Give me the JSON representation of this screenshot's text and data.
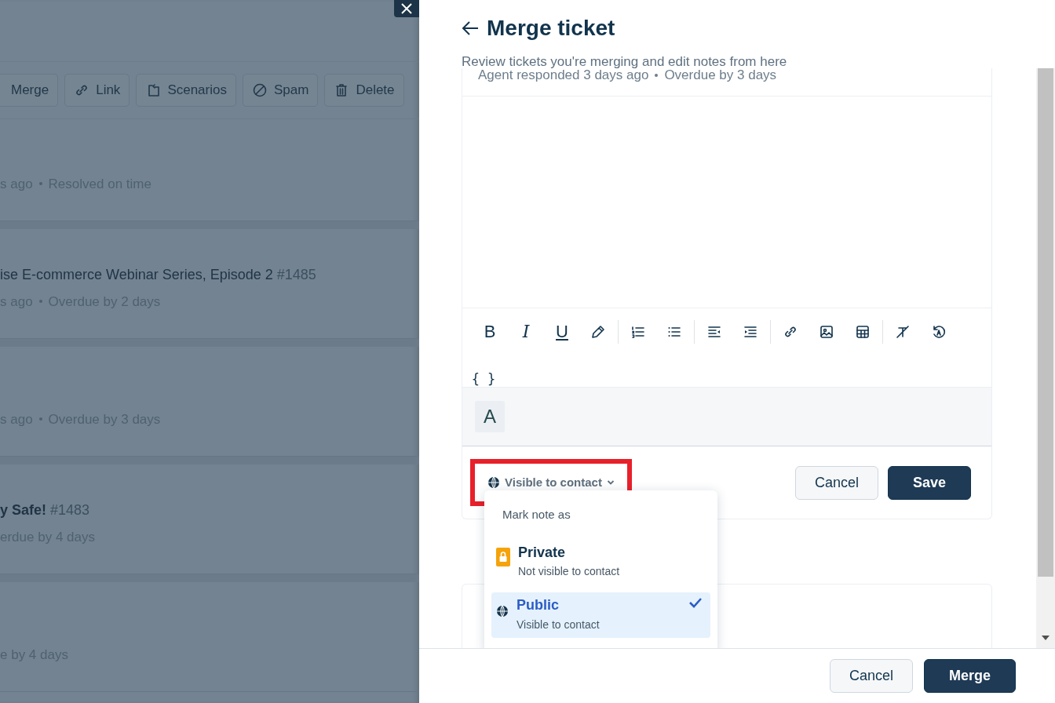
{
  "background": {
    "toolbar": [
      {
        "kind": "merge",
        "label": "Merge"
      },
      {
        "kind": "link",
        "label": "Link"
      },
      {
        "kind": "scenarios",
        "label": "Scenarios"
      },
      {
        "kind": "spam",
        "label": "Spam"
      },
      {
        "kind": "delete",
        "label": "Delete"
      }
    ],
    "tickets": [
      {
        "meta": [
          "s ago",
          "Resolved on time"
        ]
      },
      {
        "title": "ise E-commerce Webinar Series, Episode 2",
        "number": "#1485",
        "meta": [
          "s ago",
          "Overdue by 2 days"
        ]
      },
      {
        "meta": [
          "s ago",
          "Overdue by 3 days"
        ]
      },
      {
        "title": "y Safe!",
        "number": "#1483",
        "bold": true,
        "meta": [
          "erdue by 4 days"
        ]
      },
      {
        "meta": [
          "e by 4 days"
        ]
      }
    ]
  },
  "panel": {
    "title": "Merge ticket",
    "subtitle": "Review tickets you're merging and edit notes from here",
    "ticket_meta": [
      "Agent responded 3 days ago",
      "Overdue by 3 days"
    ],
    "editor_toolbar": [
      {
        "kind": "bold",
        "label": "B"
      },
      {
        "kind": "italic",
        "label": "I"
      },
      {
        "kind": "underline",
        "label": "U"
      },
      {
        "kind": "color"
      },
      {
        "kind": "separator"
      },
      {
        "kind": "ordered-list"
      },
      {
        "kind": "bullet-list"
      },
      {
        "kind": "separator"
      },
      {
        "kind": "outdent"
      },
      {
        "kind": "indent"
      },
      {
        "kind": "separator"
      },
      {
        "kind": "link"
      },
      {
        "kind": "image"
      },
      {
        "kind": "table"
      },
      {
        "kind": "separator"
      },
      {
        "kind": "clear-format"
      },
      {
        "kind": "spellcheck"
      },
      {
        "kind": "code",
        "label": "{ }"
      }
    ],
    "font_button": "A",
    "visibility": {
      "label": "Visible to contact",
      "highlighted": true
    },
    "note_buttons": [
      "Cancel",
      "Save"
    ],
    "menu": {
      "heading": "Mark note as",
      "options": [
        {
          "kind": "private",
          "label": "Private",
          "description": "Not visible to contact",
          "selected": false
        },
        {
          "kind": "public",
          "label": "Public",
          "description": "Visible to contact",
          "selected": true
        }
      ]
    },
    "footer_buttons": [
      "Cancel",
      "Merge"
    ]
  }
}
